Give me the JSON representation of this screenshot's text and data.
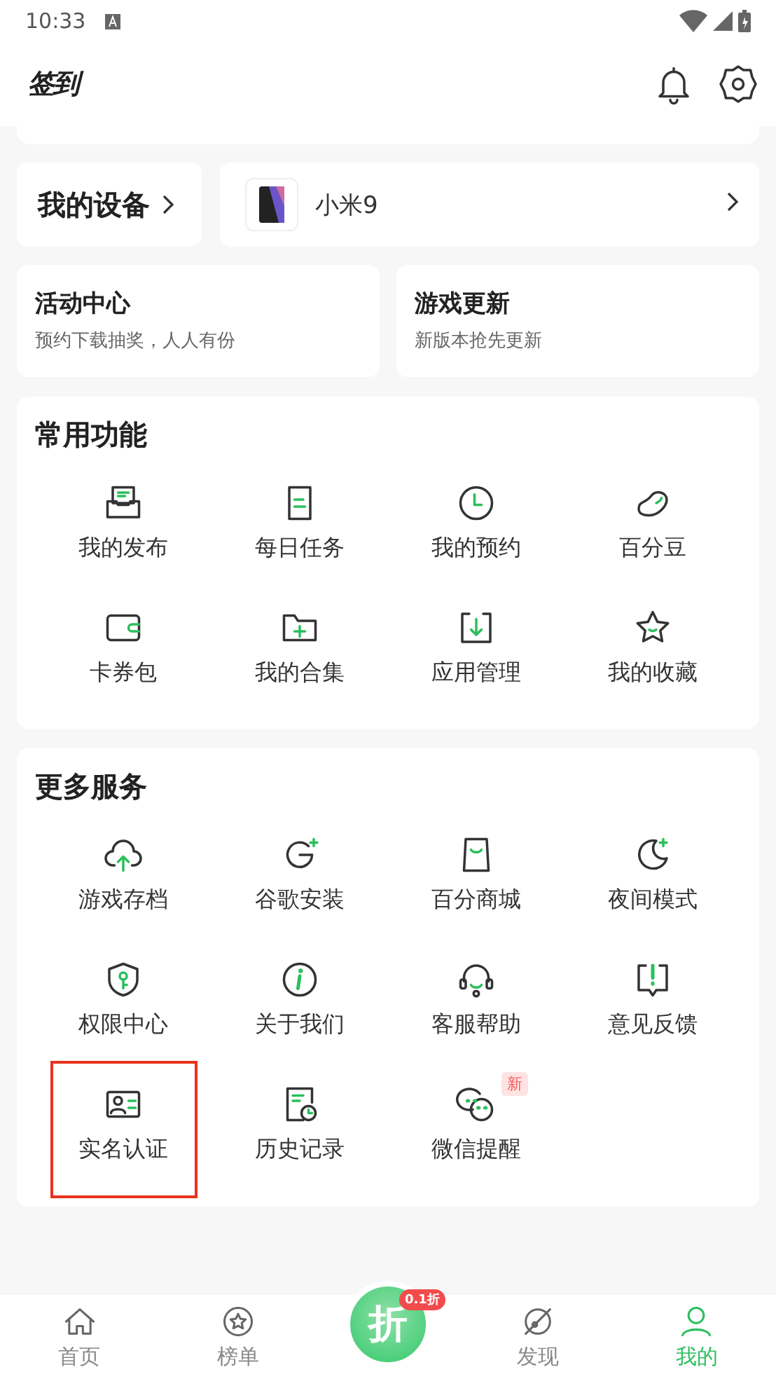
{
  "status_bar": {
    "time": "10:33"
  },
  "header": {
    "logo": "签到"
  },
  "device": {
    "title": "我的设备",
    "name": "小米9"
  },
  "promos": [
    {
      "title": "活动中心",
      "subtitle": "预约下载抽奖，人人有份"
    },
    {
      "title": "游戏更新",
      "subtitle": "新版本抢先更新"
    }
  ],
  "sections": [
    {
      "title": "常用功能",
      "items": [
        {
          "label": "我的发布"
        },
        {
          "label": "每日任务"
        },
        {
          "label": "我的预约"
        },
        {
          "label": "百分豆"
        },
        {
          "label": "卡券包"
        },
        {
          "label": "我的合集"
        },
        {
          "label": "应用管理"
        },
        {
          "label": "我的收藏"
        }
      ]
    },
    {
      "title": "更多服务",
      "items": [
        {
          "label": "游戏存档"
        },
        {
          "label": "谷歌安装"
        },
        {
          "label": "百分商城"
        },
        {
          "label": "夜间模式"
        },
        {
          "label": "权限中心"
        },
        {
          "label": "关于我们"
        },
        {
          "label": "客服帮助"
        },
        {
          "label": "意见反馈"
        },
        {
          "label": "实名认证",
          "highlighted": true
        },
        {
          "label": "历史记录"
        },
        {
          "label": "微信提醒",
          "badge": "新"
        }
      ]
    }
  ],
  "bottom_nav": {
    "center": {
      "label": "折",
      "badge": "0.1折"
    },
    "tabs": [
      {
        "label": "首页",
        "selected": false
      },
      {
        "label": "榜单",
        "selected": false
      },
      {
        "label": "发现",
        "selected": false
      },
      {
        "label": "我的",
        "selected": true
      }
    ]
  }
}
